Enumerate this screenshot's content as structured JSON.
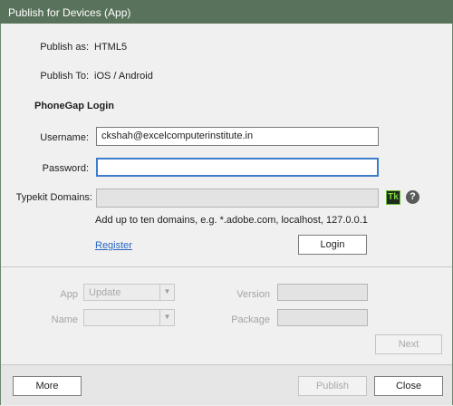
{
  "window": {
    "title": "Publish for Devices (App)"
  },
  "publish_as": {
    "label": "Publish as:",
    "value": "HTML5"
  },
  "publish_to": {
    "label": "Publish To:",
    "value": "iOS / Android"
  },
  "section": {
    "title": "PhoneGap Login"
  },
  "username": {
    "label": "Username:",
    "value": "ckshah@excelcomputerinstitute.in"
  },
  "password": {
    "label": "Password:",
    "value": ""
  },
  "typekit": {
    "label": "Typekit Domains:",
    "value": "",
    "badge": "Tk",
    "help": "?",
    "hint": "Add up to ten domains, e.g. *.adobe.com, localhost, 127.0.0.1"
  },
  "register": {
    "label": "Register"
  },
  "login_button": {
    "label": "Login"
  },
  "app": {
    "label": "App",
    "selected": "Update"
  },
  "name": {
    "label": "Name",
    "selected": ""
  },
  "version": {
    "label": "Version",
    "value": ""
  },
  "package": {
    "label": "Package",
    "value": ""
  },
  "next_button": {
    "label": "Next"
  },
  "footer": {
    "more": "More",
    "publish": "Publish",
    "close": "Close"
  }
}
